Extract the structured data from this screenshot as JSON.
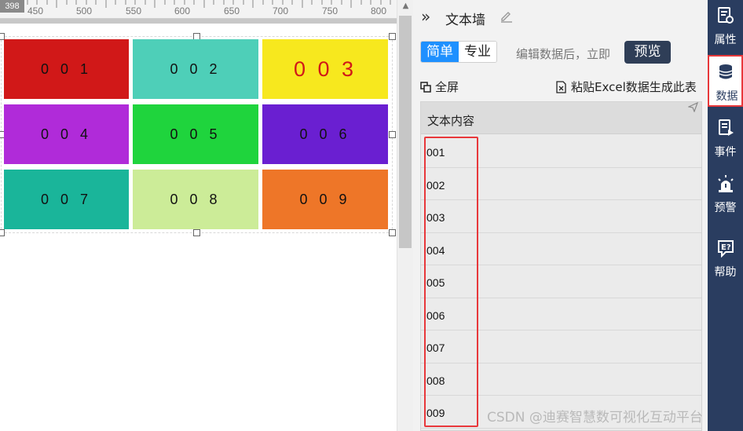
{
  "canvas": {
    "ruler_marker": "398",
    "ruler_ticks": [
      "450",
      "500",
      "550",
      "600",
      "650",
      "700",
      "750",
      "800"
    ],
    "tiles": [
      {
        "label": "0 0 1",
        "bg": "#d11818",
        "fg": "#111111"
      },
      {
        "label": "0 0 2",
        "bg": "#4ecfb8",
        "fg": "#111111"
      },
      {
        "label": "0 0 3",
        "bg": "#f7e81e",
        "fg": "#d11818"
      },
      {
        "label": "0 0 4",
        "bg": "#b02bd9",
        "fg": "#111111"
      },
      {
        "label": "0 0 5",
        "bg": "#1fd43d",
        "fg": "#111111"
      },
      {
        "label": "0 0 6",
        "bg": "#6a1fd1",
        "fg": "#111111"
      },
      {
        "label": "0 0 7",
        "bg": "#1ab59a",
        "fg": "#111111"
      },
      {
        "label": "0 0 8",
        "bg": "#ccec98",
        "fg": "#111111"
      },
      {
        "label": "0 0 9",
        "bg": "#ee7628",
        "fg": "#111111"
      }
    ]
  },
  "panel": {
    "title": "文本墙",
    "modes": {
      "simple": "简单",
      "pro": "专业",
      "active": "simple"
    },
    "hint": "编辑数据后，立即",
    "preview_label": "预览",
    "fullscreen_label": "全屏",
    "paste_label": "粘贴Excel数据生成此表",
    "table": {
      "header": "文本内容",
      "rows": [
        "001",
        "002",
        "003",
        "004",
        "005",
        "006",
        "007",
        "008",
        "009"
      ]
    }
  },
  "toolbar": {
    "items": [
      {
        "name": "attributes",
        "label": "属性",
        "icon": "properties-icon"
      },
      {
        "name": "data",
        "label": "数据",
        "icon": "database-icon",
        "active": true
      },
      {
        "name": "events",
        "label": "事件",
        "icon": "event-icon"
      },
      {
        "name": "alerts",
        "label": "预警",
        "icon": "alarm-icon"
      },
      {
        "name": "help",
        "label": "帮助",
        "icon": "help-icon"
      }
    ]
  },
  "watermark": "CSDN @迪赛智慧数可视化互动平台",
  "colors": {
    "toolbar_bg": "#2a3d60",
    "accent_blue": "#1e90ff",
    "highlight_red": "#e8383b",
    "preview_btn": "#2f3e57"
  }
}
